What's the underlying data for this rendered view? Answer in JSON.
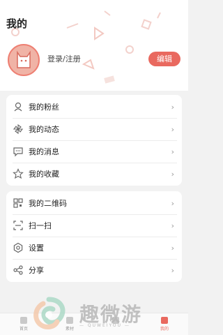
{
  "header": {
    "title": "我的",
    "login_label": "登录/注册",
    "edit_label": "编辑"
  },
  "menu_group_1": [
    {
      "label": "我的粉丝",
      "icon": "fans-icon"
    },
    {
      "label": "我的动态",
      "icon": "pinwheel-icon"
    },
    {
      "label": "我的消息",
      "icon": "message-icon"
    },
    {
      "label": "我的收藏",
      "icon": "star-icon"
    }
  ],
  "menu_group_2": [
    {
      "label": "我的二维码",
      "icon": "qrcode-icon"
    },
    {
      "label": "扫一扫",
      "icon": "scan-icon"
    },
    {
      "label": "设置",
      "icon": "gear-icon"
    },
    {
      "label": "分享",
      "icon": "share-icon"
    }
  ],
  "tabbar": [
    {
      "label": "首页",
      "active": false
    },
    {
      "label": "素材",
      "active": false
    },
    {
      "label": "",
      "active": false
    },
    {
      "label": "我的",
      "active": true
    }
  ],
  "watermark": {
    "title": "趣微游",
    "subtitle": "— QUWEIYOU —"
  },
  "colors": {
    "accent": "#e9695f",
    "background": "#f2f2f2"
  }
}
